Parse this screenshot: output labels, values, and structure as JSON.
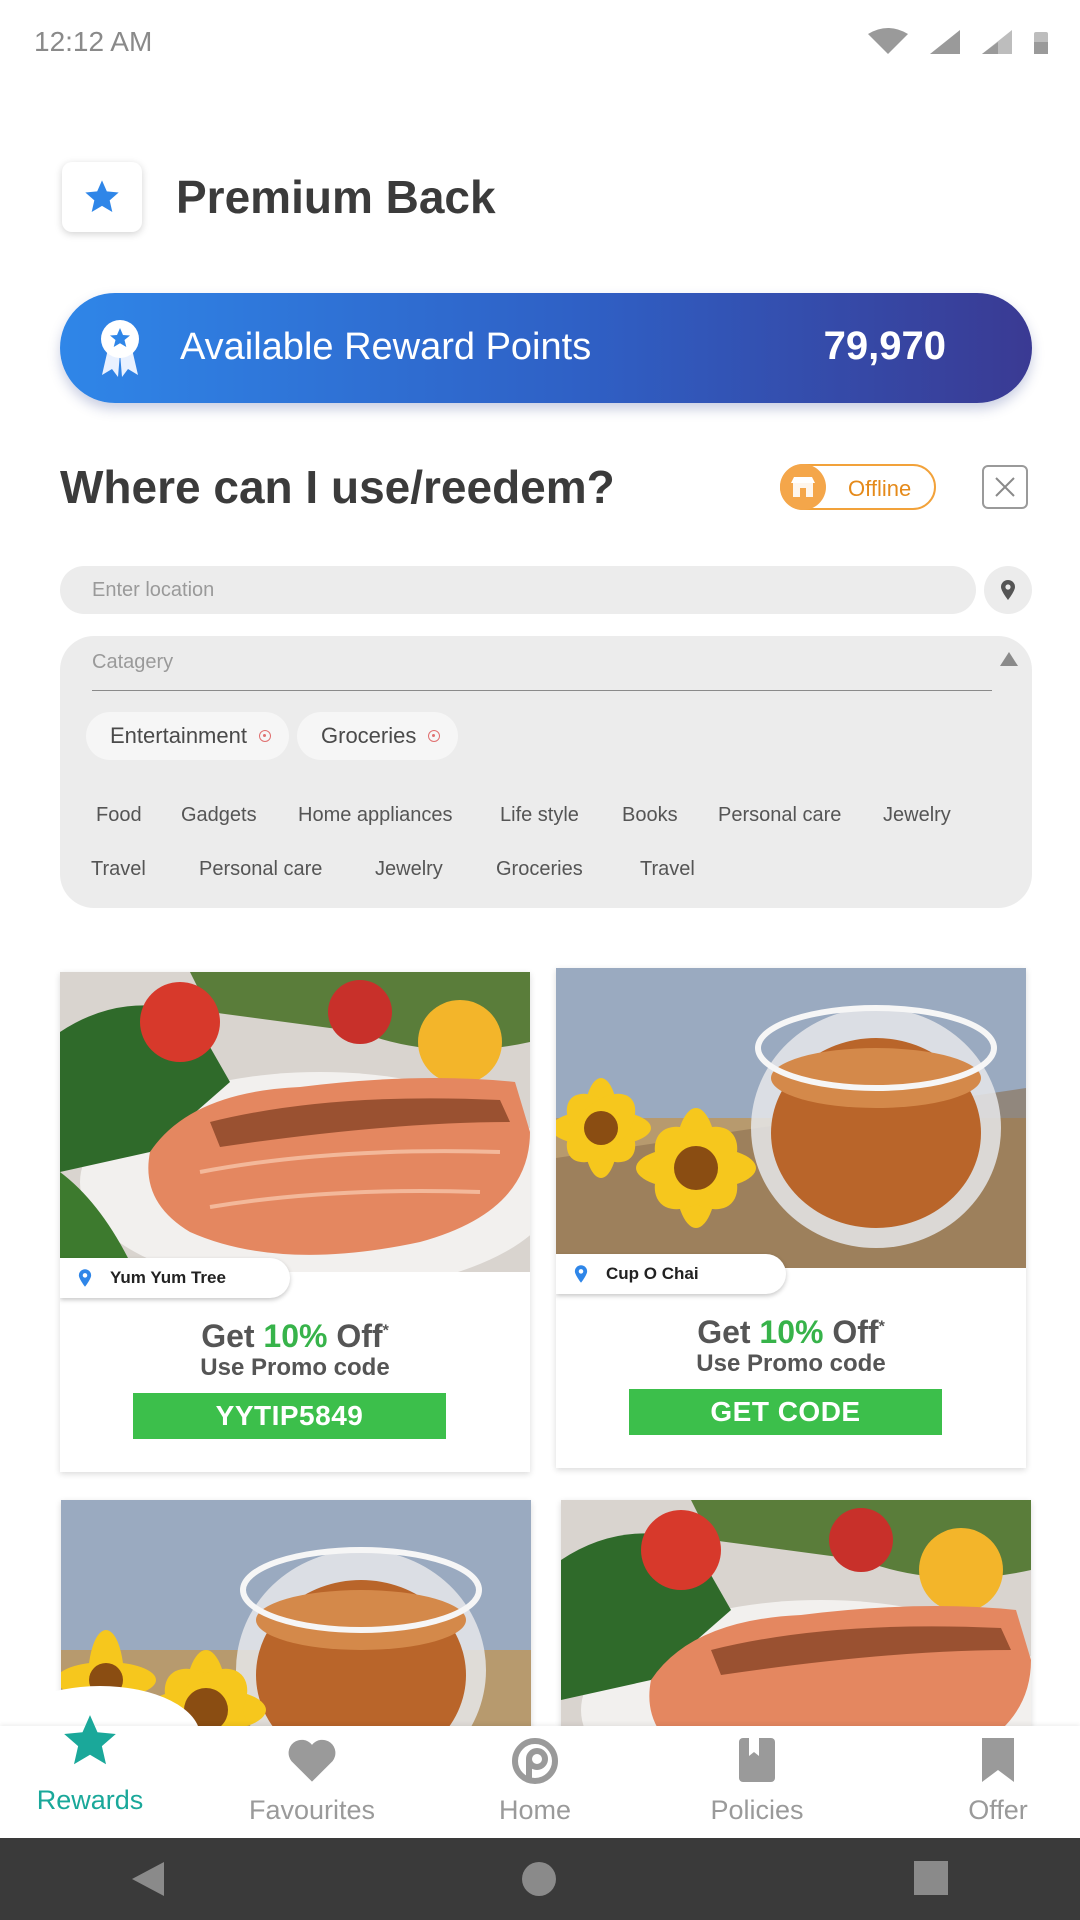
{
  "status_bar": {
    "time": "12:12 AM"
  },
  "header": {
    "app_title": "Premium Back"
  },
  "reward": {
    "label": "Available Reward Points",
    "points": "79,970"
  },
  "section": {
    "heading": "Where can I use/reedem?",
    "mode_label": "Offline"
  },
  "location": {
    "placeholder": "Enter location"
  },
  "category": {
    "label": "Catagery",
    "selected": [
      "Entertainment",
      "Groceries"
    ],
    "options_row1": [
      "Food",
      "Gadgets",
      "Home appliances",
      "Life style",
      "Books",
      "Personal care",
      "Jewelry"
    ],
    "options_row2": [
      "Travel",
      "Personal care",
      "Jewelry",
      "Groceries",
      "Travel"
    ]
  },
  "offers": [
    {
      "store": "Yum Yum Tree",
      "get": "Get",
      "percent": "10%",
      "off": "Off",
      "asterisk": "*",
      "promo_label": "Use Promo code",
      "code": "YYTIP5849",
      "image": "salmon-dish"
    },
    {
      "store": "Cup O Chai",
      "get": "Get",
      "percent": "10%",
      "off": "Off",
      "asterisk": "*",
      "promo_label": "Use Promo code",
      "code": "GET CODE",
      "image": "tea-cup-flowers"
    },
    {
      "image": "tea-cup-flowers"
    },
    {
      "image": "salmon-dish"
    }
  ],
  "bottom_nav": {
    "items": [
      {
        "label": "Rewards",
        "icon": "star-icon",
        "active": true
      },
      {
        "label": "Favourites",
        "icon": "heart-icon"
      },
      {
        "label": "Home",
        "icon": "home-logo-icon"
      },
      {
        "label": "Policies",
        "icon": "book-icon"
      },
      {
        "label": "Offer",
        "icon": "bookmark-icon"
      }
    ]
  },
  "colors": {
    "accent": "#2f86e8",
    "active_nav": "#1aa89a",
    "green": "#3cbf4b",
    "orange": "#f2a23a"
  }
}
